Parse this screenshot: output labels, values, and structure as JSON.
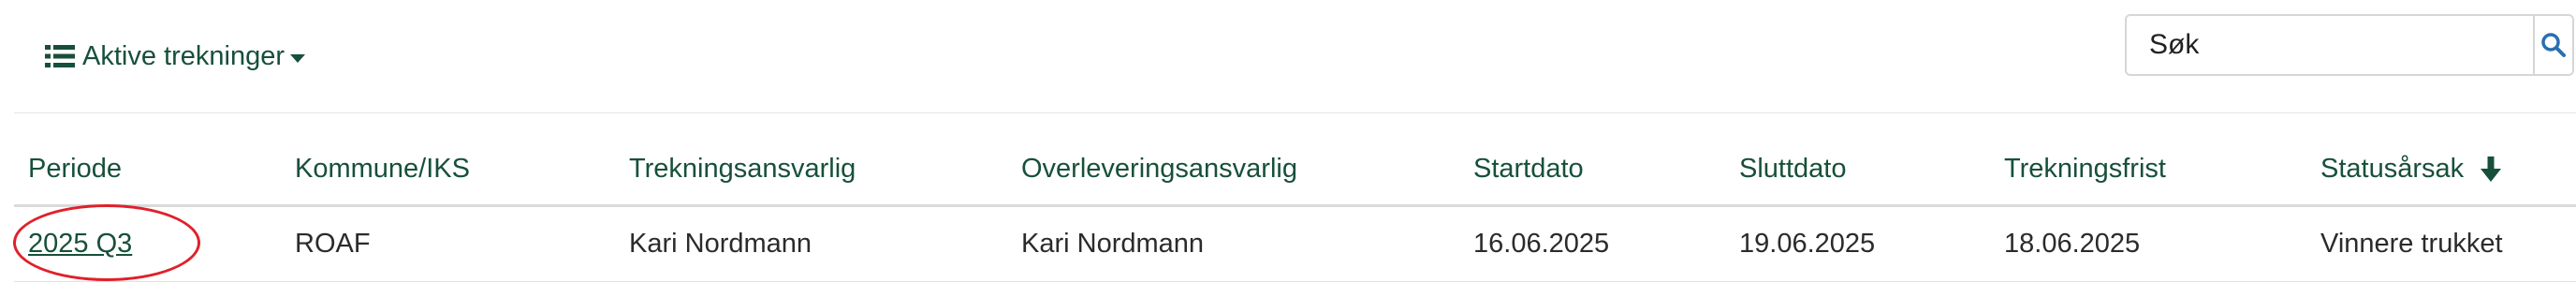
{
  "toolbar": {
    "view_selector_label": "Aktive trekninger",
    "view_selector_icon": "list-icon",
    "search_placeholder": "Søk",
    "search_icon": "search-icon",
    "accent_color": "#17503a",
    "search_icon_color": "#2a6fb0"
  },
  "table": {
    "columns": [
      "Periode",
      "Kommune/IKS",
      "Trekningsansvarlig",
      "Overleveringsansvarlig",
      "Startdato",
      "Sluttdato",
      "Trekningsfrist",
      "Statusårsak"
    ],
    "sorted_column": "Statusårsak",
    "sort_direction": "descending",
    "sort_icon": "arrow-down-icon",
    "rows": [
      {
        "periode": "2025 Q3",
        "kommune": "ROAF",
        "trekningsansvarlig": "Kari Nordmann",
        "overleveringsansvarlig": "Kari Nordmann",
        "startdato": "16.06.2025",
        "sluttdato": "19.06.2025",
        "trekningsfrist": "18.06.2025",
        "statusarsak": "Vinnere trukket"
      }
    ]
  },
  "annotation": {
    "highlight_color": "#e0202a"
  }
}
